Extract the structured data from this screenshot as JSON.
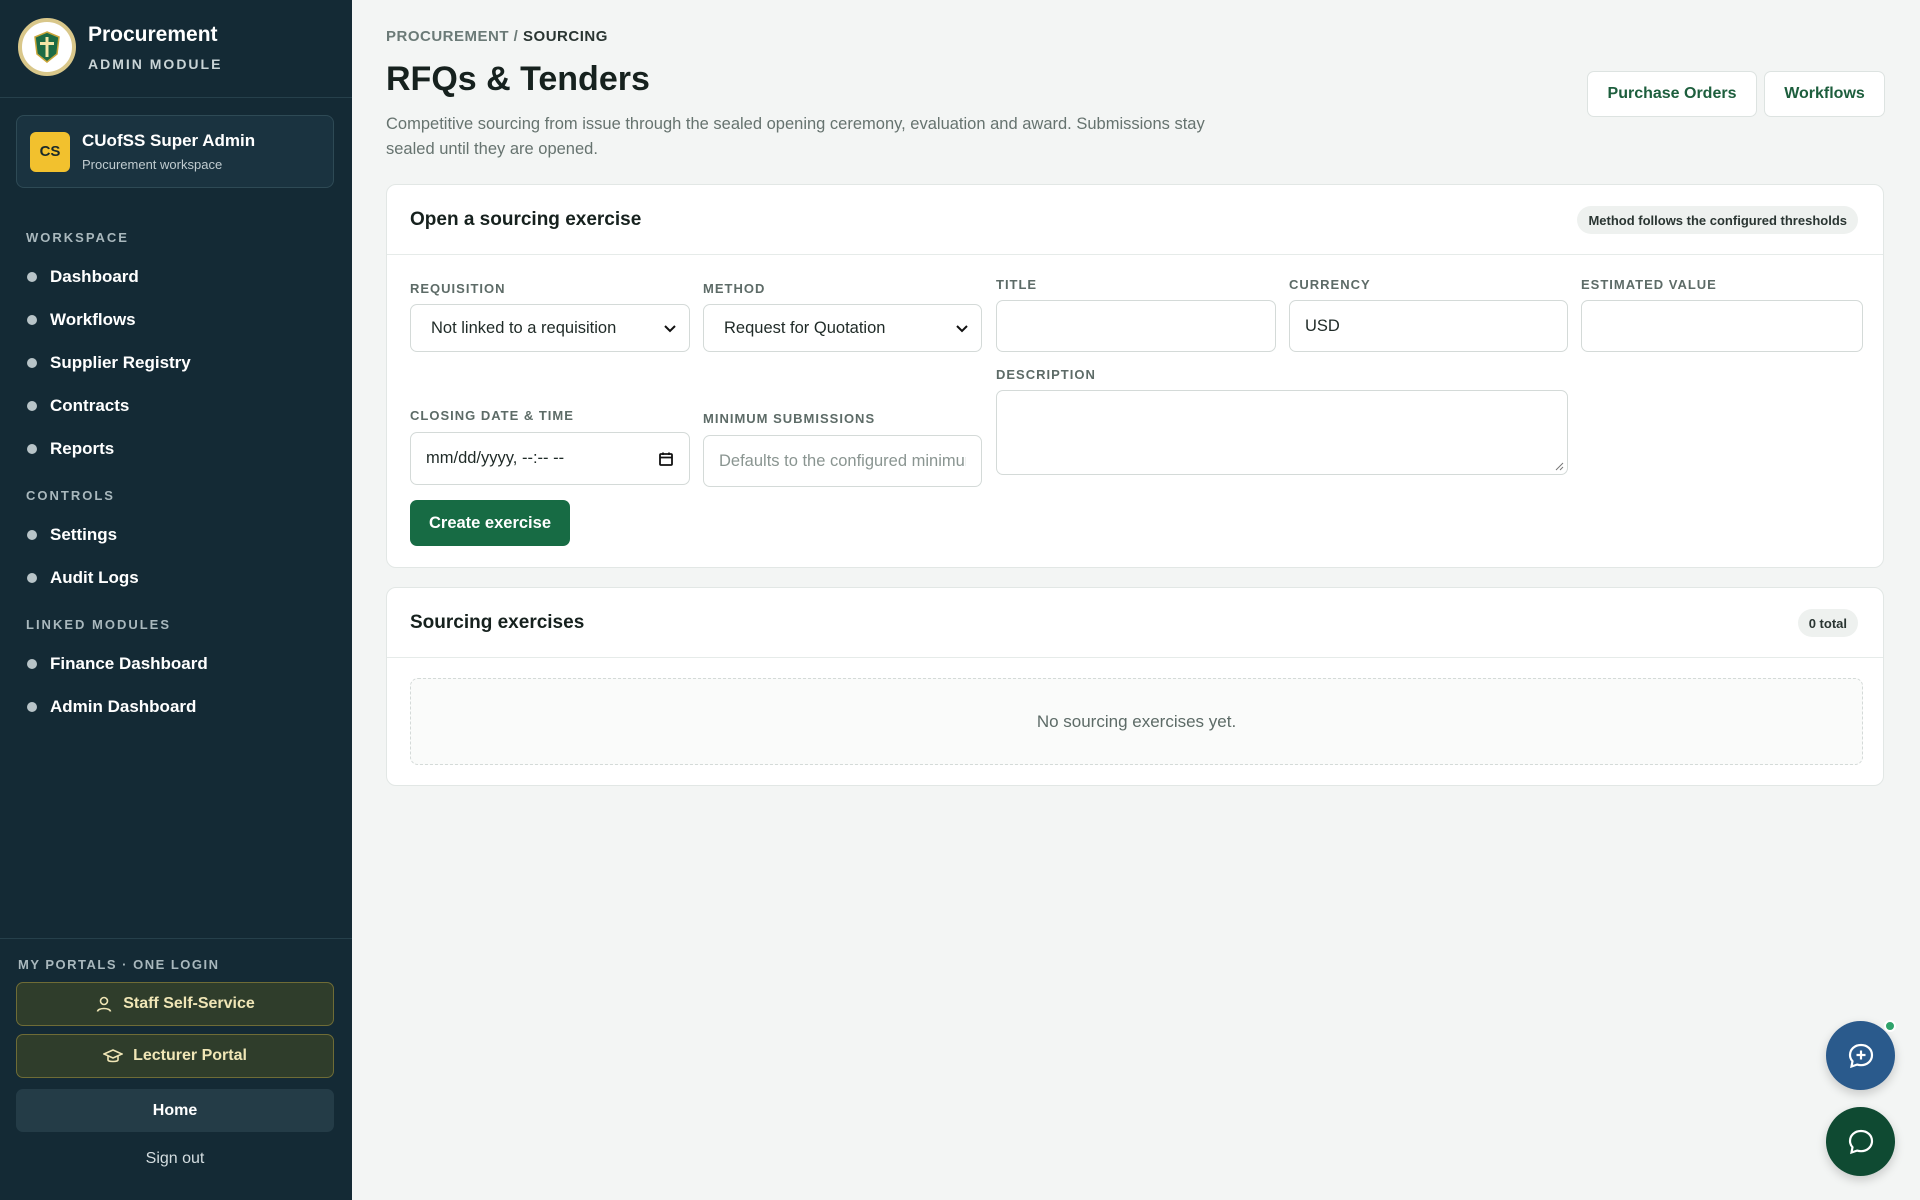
{
  "sidebar": {
    "brand_title": "Procurement",
    "brand_subtitle": "ADMIN MODULE",
    "user": {
      "initials": "CS",
      "name": "CUofSS Super Admin",
      "subtitle": "Procurement workspace"
    },
    "sections": [
      {
        "label": "WORKSPACE",
        "items": [
          "Dashboard",
          "Workflows",
          "Supplier Registry",
          "Contracts",
          "Reports"
        ]
      },
      {
        "label": "CONTROLS",
        "items": [
          "Settings",
          "Audit Logs"
        ]
      },
      {
        "label": "LINKED MODULES",
        "items": [
          "Finance Dashboard",
          "Admin Dashboard"
        ]
      }
    ],
    "portals_label": "MY PORTALS · ONE LOGIN",
    "portals": [
      "Staff Self-Service",
      "Lecturer Portal"
    ],
    "home_label": "Home",
    "signout_label": "Sign out"
  },
  "header": {
    "breadcrumb_root": "PROCUREMENT",
    "breadcrumb_sep": " / ",
    "breadcrumb_current": "SOURCING",
    "title": "RFQs & Tenders",
    "description": "Competitive sourcing from issue through the sealed opening ceremony, evaluation and award. Submissions stay sealed until they are opened.",
    "buttons": [
      "Purchase Orders",
      "Workflows"
    ]
  },
  "form_card": {
    "title": "Open a sourcing exercise",
    "badge": "Method follows the configured thresholds",
    "fields": {
      "requisition": {
        "label": "REQUISITION",
        "value": "Not linked to a requisition"
      },
      "method": {
        "label": "METHOD",
        "value": "Request for Quotation"
      },
      "title": {
        "label": "TITLE",
        "value": ""
      },
      "currency": {
        "label": "CURRENCY",
        "value": "USD"
      },
      "estimated_value": {
        "label": "ESTIMATED VALUE",
        "value": ""
      },
      "description": {
        "label": "DESCRIPTION",
        "value": ""
      },
      "closing": {
        "label": "CLOSING DATE & TIME",
        "value": "mm/dd/yyyy, --:-- --"
      },
      "min_submissions": {
        "label": "MINIMUM SUBMISSIONS",
        "placeholder": "Defaults to the configured minimum"
      }
    },
    "submit_label": "Create exercise"
  },
  "list_card": {
    "title": "Sourcing exercises",
    "badge": "0 total",
    "empty_text": "No sourcing exercises yet."
  },
  "colors": {
    "sidebar_bg": "#142a35",
    "accent_green": "#176b44",
    "chat_fab_blue": "#2a5a8c",
    "chat_fab_green": "#0f4a32",
    "avatar_yellow": "#f2c12e"
  },
  "icons": [
    "logo-emblem",
    "user-icon",
    "graduation-cap-icon",
    "ai-chat-icon",
    "chat-bubble-icon",
    "calendar-icon",
    "chevron-down-icon"
  ]
}
